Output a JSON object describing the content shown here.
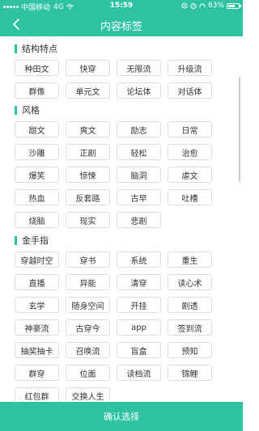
{
  "status_bar": {
    "carrier": "中国移动",
    "network": "4G",
    "time": "15:59",
    "battery": "63%",
    "battery_level": 0.63
  },
  "nav": {
    "title": "内容标签"
  },
  "sections": [
    {
      "title": "结构特点",
      "tags": [
        "种田文",
        "快穿",
        "无限流",
        "升级流",
        "群像",
        "单元文",
        "论坛体",
        "对话体"
      ]
    },
    {
      "title": "风格",
      "tags": [
        "甜文",
        "爽文",
        "励志",
        "日常",
        "沙雕",
        "正剧",
        "轻松",
        "治愈",
        "爆笑",
        "惊悚",
        "脑洞",
        "虐文",
        "热血",
        "反套路",
        "古早",
        "吐槽",
        "烧脑",
        "现实",
        "悲剧"
      ]
    },
    {
      "title": "金手指",
      "tags": [
        "穿越时空",
        "穿书",
        "系统",
        "重生",
        "直播",
        "异能",
        "清穿",
        "读心术",
        "玄学",
        "随身空间",
        "开挂",
        "剧透",
        "神豪流",
        "古穿今",
        "app",
        "签到流",
        "抽奖抽卡",
        "召唤流",
        "盲盒",
        "预知",
        "群穿",
        "位面",
        "读档流",
        "锦鲤",
        "红包群",
        "交换人生"
      ]
    }
  ],
  "confirm_label": "确认选择",
  "colors": {
    "accent": "#2ec2a3",
    "tag_border": "#dedede"
  }
}
